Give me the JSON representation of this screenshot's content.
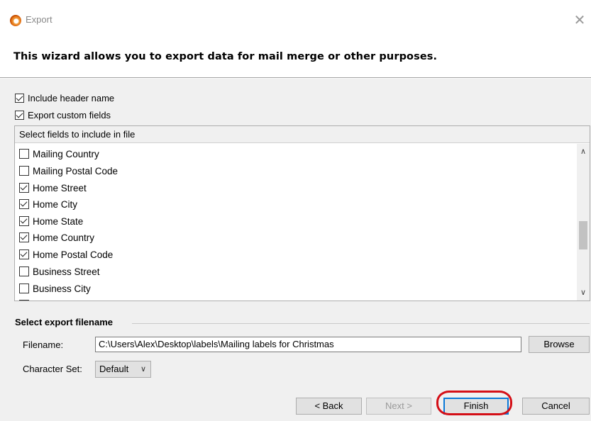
{
  "window": {
    "title": "Export",
    "close_glyph": "✕",
    "icon": "app-logo-icon"
  },
  "heading": "This wizard allows you to export data for mail merge or other purposes.",
  "options": [
    {
      "label": "Include header name",
      "checked": true
    },
    {
      "label": "Export custom fields",
      "checked": true
    }
  ],
  "fields_list": {
    "header": "Select fields to include in file",
    "items": [
      {
        "label": "Mailing Country",
        "checked": false
      },
      {
        "label": "Mailing Postal Code",
        "checked": false
      },
      {
        "label": "Home Street",
        "checked": true
      },
      {
        "label": "Home City",
        "checked": true
      },
      {
        "label": "Home State",
        "checked": true
      },
      {
        "label": "Home Country",
        "checked": true
      },
      {
        "label": "Home Postal Code",
        "checked": true
      },
      {
        "label": "Business Street",
        "checked": false
      },
      {
        "label": "Business City",
        "checked": false
      },
      {
        "label": "",
        "checked": false
      }
    ],
    "scroll_up_glyph": "∧",
    "scroll_down_glyph": "∨"
  },
  "export_group": {
    "title": "Select export filename",
    "filename_label": "Filename:",
    "filename_value": "C:\\Users\\Alex\\Desktop\\labels\\Mailing labels for Christmas",
    "browse_label": "Browse",
    "charset_label": "Character Set:",
    "charset_value": "Default",
    "charset_chevron": "∨"
  },
  "buttons": {
    "back": "< Back",
    "next": "Next >",
    "finish": "Finish",
    "cancel": "Cancel"
  },
  "colors": {
    "accent": "#0a78d7",
    "annotation": "#d40f17"
  }
}
